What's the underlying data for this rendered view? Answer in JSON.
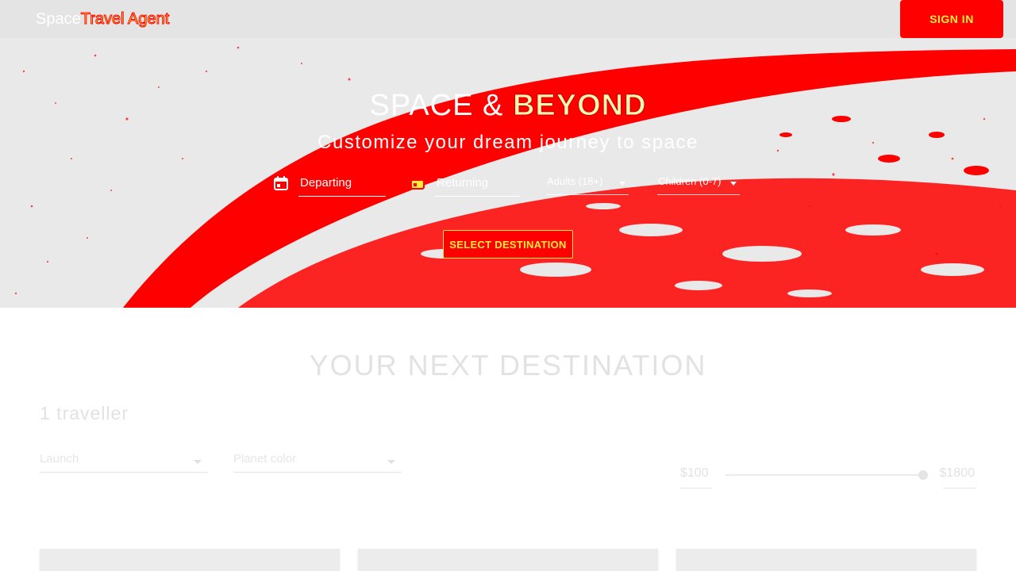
{
  "app": {
    "brand_prefix": "Space",
    "brand_suffix": "Travel Agent"
  },
  "header": {
    "signin_label": "SIGN IN"
  },
  "hero": {
    "title_light": "SPACE & ",
    "title_strong": "BEYOND",
    "subtitle": "Customize your dream journey to space"
  },
  "search": {
    "departing_label": "Departing",
    "returning_label": "Returning",
    "adults_label": "Adults (18+)",
    "children_label": "Children (0-7)",
    "select_destination_label": "SELECT DESTINATION"
  },
  "results": {
    "section_title": "YOUR NEXT DESTINATION",
    "travellers": "1 traveller",
    "filters": {
      "launch_label": "Launch",
      "planet_color_label": "Planet color"
    },
    "price": {
      "min": "$100",
      "max": "$1800"
    }
  },
  "colors": {
    "accent": "#ff0000",
    "accent_text": "#ffec3d",
    "hero_bg": "#e9e9e9"
  }
}
